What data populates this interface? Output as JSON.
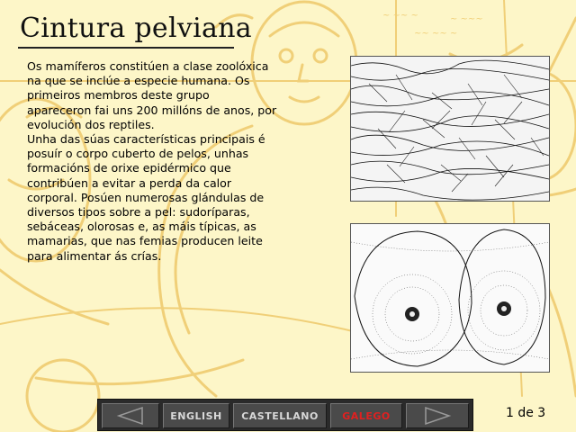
{
  "title": "Cintura pelviana",
  "body_text": "Os mamíferos constitúen a clase zoolóxica\nna que se inclúe a especie humana. Os\nprimeiros membros deste grupo\napareceron fai uns 200 millóns de anos, por\nevolución dos reptiles.\nUnha das súas características principais é\nposuír o corpo cuberto de pelos, unhas\nformacións de orixe epidérmico que\ncontribúen a evitar a perda da calor\ncorporal. Posúen numerosas glándulas de\ndiversos tipos sobre a pel: sudoríparas,\nsebáceas, olorosas e, as máis típicas, as\nmamarias, que nas femias producen leite\npara alimentar ás crías.",
  "toolbar": {
    "prev_icon": "triangle-left-icon",
    "english_label": "ENGLISH",
    "castellano_label": "CASTELLANO",
    "galego_label": "GALEGO",
    "next_icon": "triangle-right-icon",
    "active_language": "GALEGO",
    "active_color": "#e02020"
  },
  "page_counter": "1 de 3",
  "colors": {
    "background": "#fdf6c8",
    "sketch": "#f2d27a",
    "toolbar": "#2a2a2a"
  }
}
